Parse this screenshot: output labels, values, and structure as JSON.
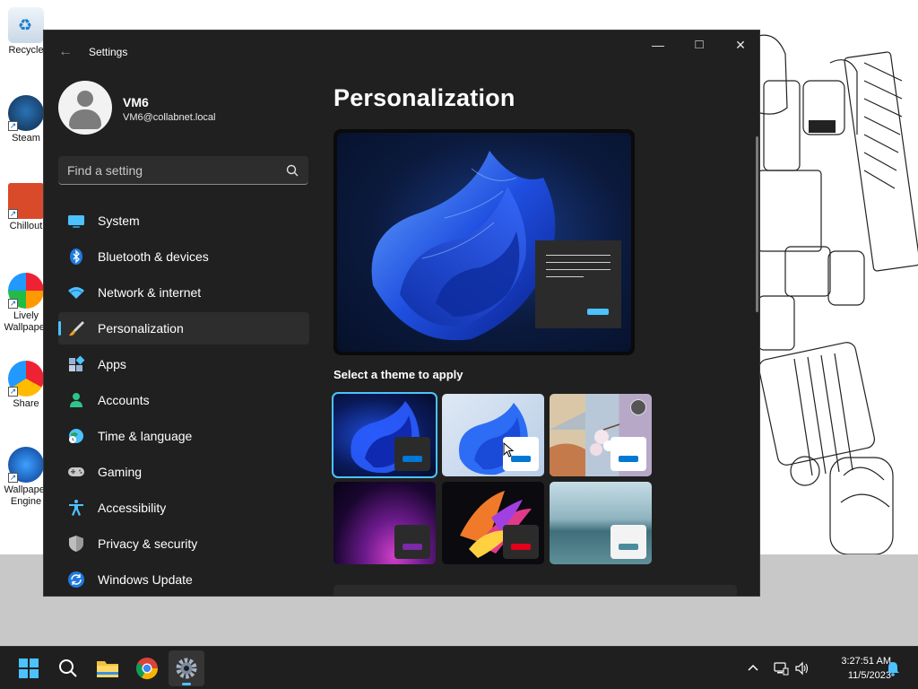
{
  "desktop": {
    "icons": [
      {
        "label": "Recycle",
        "name": "recycle-bin"
      },
      {
        "label": "Steam",
        "name": "steam"
      },
      {
        "label": "Chillout",
        "name": "chillout"
      },
      {
        "label": "Lively Wallpaper",
        "name": "lively-wallpaper"
      },
      {
        "label": "Share",
        "name": "share"
      },
      {
        "label": "Wallpaper Engine",
        "name": "wallpaper-engine"
      }
    ]
  },
  "window": {
    "title": "Settings",
    "controls": {
      "minimize": "—",
      "maximize": "□",
      "close": "✕"
    }
  },
  "user": {
    "name": "VM6",
    "email": "VM6@collabnet.local"
  },
  "search": {
    "placeholder": "Find a setting"
  },
  "nav": [
    {
      "label": "System",
      "icon": "monitor-icon",
      "active": false
    },
    {
      "label": "Bluetooth & devices",
      "icon": "bluetooth-icon",
      "active": false
    },
    {
      "label": "Network & internet",
      "icon": "wifi-icon",
      "active": false
    },
    {
      "label": "Personalization",
      "icon": "brush-icon",
      "active": true
    },
    {
      "label": "Apps",
      "icon": "apps-icon",
      "active": false
    },
    {
      "label": "Accounts",
      "icon": "person-icon",
      "active": false
    },
    {
      "label": "Time & language",
      "icon": "globe-clock-icon",
      "active": false
    },
    {
      "label": "Gaming",
      "icon": "gamepad-icon",
      "active": false
    },
    {
      "label": "Accessibility",
      "icon": "accessibility-icon",
      "active": false
    },
    {
      "label": "Privacy & security",
      "icon": "shield-icon",
      "active": false
    },
    {
      "label": "Windows Update",
      "icon": "update-icon",
      "active": false
    }
  ],
  "content": {
    "title": "Personalization",
    "theme_section_label": "Select a theme to apply",
    "themes": [
      {
        "name": "windows-dark",
        "selected": true,
        "accent": "#0078d4"
      },
      {
        "name": "windows-light",
        "selected": false,
        "accent": "#0078d4"
      },
      {
        "name": "windows-spotlight",
        "selected": false,
        "accent": "#0078d4"
      },
      {
        "name": "glow",
        "selected": false,
        "accent": "#7a2aa6"
      },
      {
        "name": "captured-motion",
        "selected": false,
        "accent": "#e3001b"
      },
      {
        "name": "flow",
        "selected": false,
        "accent": "#4a8c9e"
      }
    ]
  },
  "taskbar": {
    "apps": [
      "start-icon",
      "search-icon",
      "file-explorer-icon",
      "chrome-icon",
      "settings-icon"
    ],
    "active_app": "settings-icon",
    "time": "3:27:51 AM",
    "date": "11/5/2023"
  },
  "colors": {
    "accent": "#4cc2ff",
    "window_bg": "#202020",
    "nav_active_bg": "#2d2d2d",
    "taskbar_bg": "#1f1f1f"
  }
}
